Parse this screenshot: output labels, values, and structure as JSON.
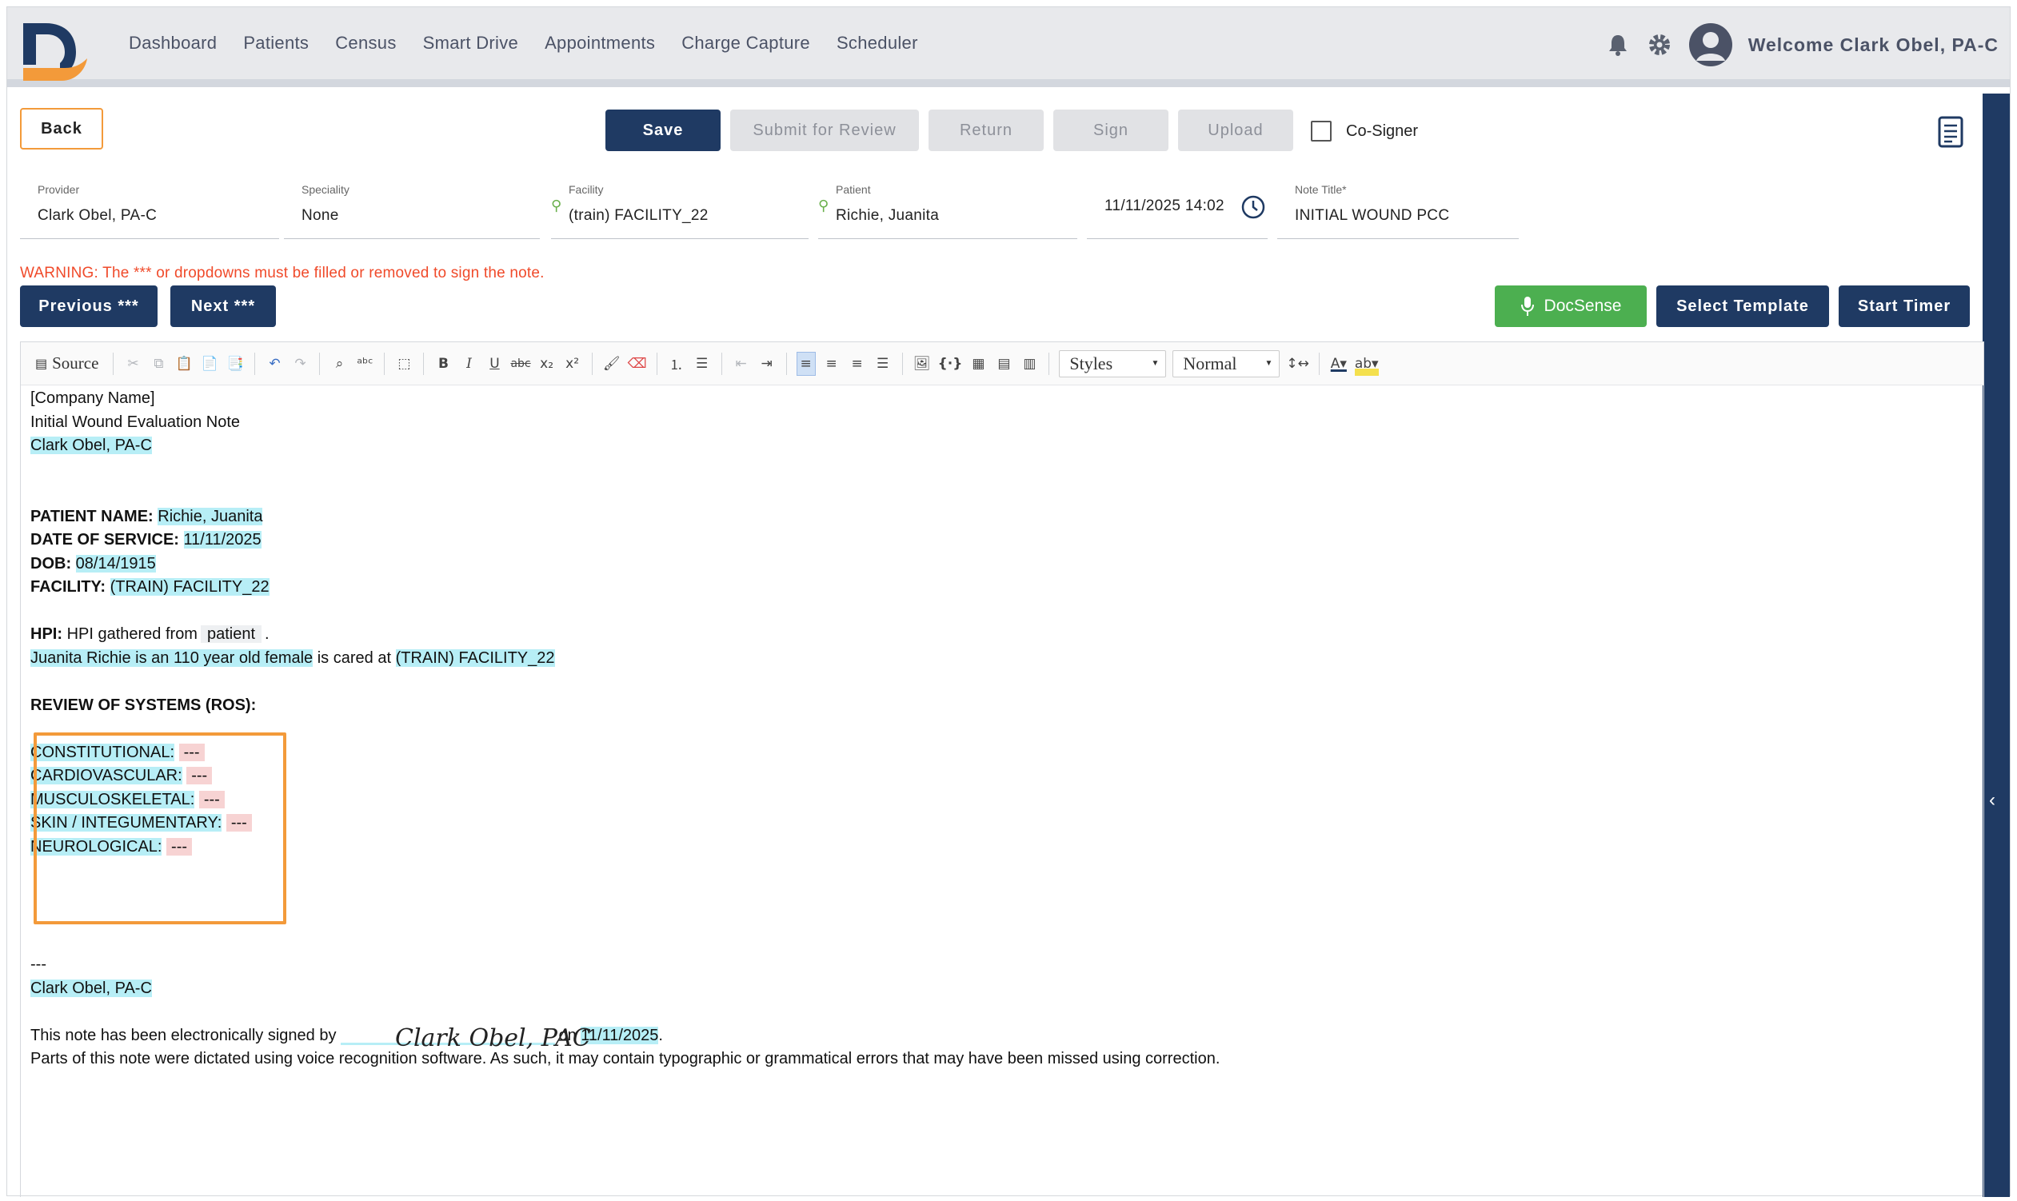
{
  "nav": {
    "items": [
      "Dashboard",
      "Patients",
      "Census",
      "Smart Drive",
      "Appointments",
      "Charge Capture",
      "Scheduler"
    ],
    "welcome": "Welcome Clark Obel, PA-C",
    "logo_letter": "D",
    "brand_color": "#1f3a63",
    "accent_color": "#f39a3a"
  },
  "actions": {
    "back": "Back",
    "save": "Save",
    "submit": "Submit for Review",
    "return": "Return",
    "sign": "Sign",
    "upload": "Upload",
    "cosigner": "Co-Signer",
    "cosigner_checked": false
  },
  "fields": {
    "provider_label": "Provider",
    "provider": "Clark Obel, PA-C",
    "speciality_label": "Speciality",
    "speciality": "None",
    "facility_label": "Facility",
    "facility": "(train) FACILITY_22",
    "patient_label": "Patient",
    "patient": "Richie, Juanita",
    "datetime": "11/11/2025 14:02",
    "note_title_label": "Note Title*",
    "note_title": "INITIAL WOUND PCC"
  },
  "warning": "WARNING: The *** or dropdowns must be filled or removed to sign the note.",
  "nav_buttons": {
    "previous": "Previous ***",
    "next": "Next ***",
    "docsense": "DocSense",
    "select_template": "Select Template",
    "start_timer": "Start Timer"
  },
  "toolbar": {
    "source": "Source",
    "styles": "Styles",
    "format": "Normal"
  },
  "note": {
    "company": "[Company Name]",
    "title": "Initial Wound Evaluation Note",
    "provider": "Clark Obel, PA-C",
    "patient_name_label": "PATIENT NAME:",
    "patient_name": "Richie, Juanita",
    "dos_label": "DATE OF SERVICE:",
    "dos": "11/11/2025",
    "dob_label": "DOB:",
    "dob": "08/14/1915",
    "facility_label": "FACILITY:",
    "facility": "(TRAIN) FACILITY_22",
    "hpi_label": "HPI:",
    "hpi_text": "HPI gathered from",
    "hpi_source": "patient",
    "hpi_period": ".",
    "hpi_sentence": "Juanita Richie is an 110 year old female",
    "hpi_cared": "is cared at",
    "hpi_facility": "(TRAIN) FACILITY_22",
    "ros_heading": "REVIEW OF SYSTEMS (ROS):",
    "ros": [
      {
        "label": "CONSTITUTIONAL:",
        "value": "---"
      },
      {
        "label": "CARDIOVASCULAR:",
        "value": "---"
      },
      {
        "label": "MUSCULOSKELETAL:",
        "value": "---"
      },
      {
        "label": "SKIN / INTEGUMENTARY:",
        "value": "---"
      },
      {
        "label": "NEUROLOGICAL:",
        "value": "---"
      }
    ],
    "separator": "---",
    "sign_provider": "Clark Obel, PA-C",
    "signature": "Clark Obel, PAC",
    "signed_text": "This note has been electronically signed by",
    "signed_on": "on",
    "signed_date": "11/11/2025",
    "signed_period": ".",
    "disclaimer": "Parts of this note were dictated using voice recognition software. As such, it may contain typographic or grammatical errors that may have been missed using correction."
  }
}
